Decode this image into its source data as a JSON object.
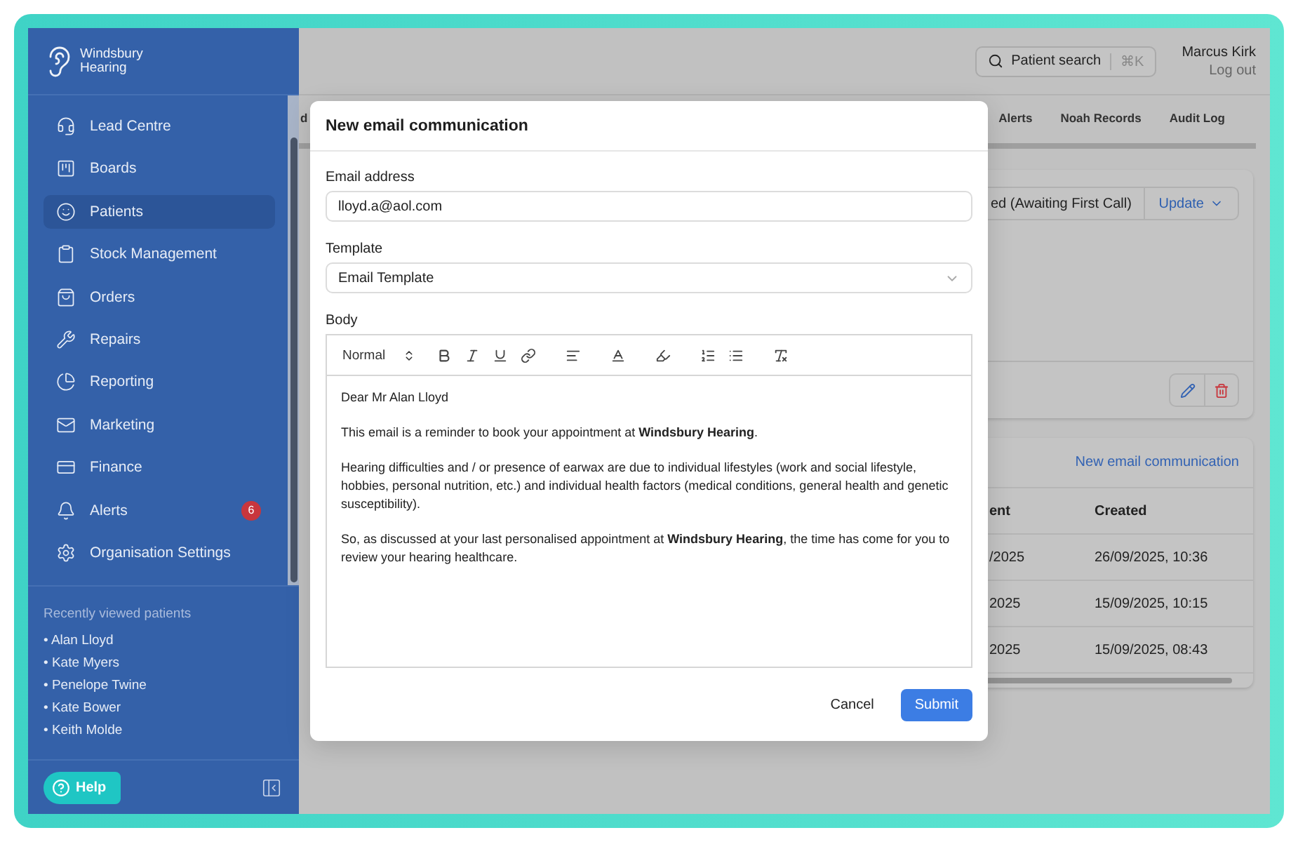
{
  "brand": {
    "lines": [
      "Windsbury",
      "Hearing"
    ]
  },
  "sidebar": {
    "items": [
      {
        "label": "Lead Centre",
        "selected": false
      },
      {
        "label": "Boards",
        "selected": false
      },
      {
        "label": "Patients",
        "selected": true
      },
      {
        "label": "Stock Management",
        "selected": false
      },
      {
        "label": "Orders",
        "selected": false
      },
      {
        "label": "Repairs",
        "selected": false
      },
      {
        "label": "Reporting",
        "selected": false
      },
      {
        "label": "Marketing",
        "selected": false
      },
      {
        "label": "Finance",
        "selected": false
      },
      {
        "label": "Alerts",
        "selected": false,
        "badge": "6"
      },
      {
        "label": "Organisation Settings",
        "selected": false
      }
    ]
  },
  "recent": {
    "title": "Recently viewed patients",
    "patients": [
      "• Alan Lloyd",
      "• Kate Myers",
      "• Penelope Twine",
      "• Kate Bower",
      "• Keith Molde"
    ]
  },
  "help": "Help",
  "header": {
    "search": {
      "label": "Patient search",
      "shortcut": "⌘K"
    },
    "user": {
      "name": "Marcus Kirk",
      "action": "Log out"
    }
  },
  "tabs": [
    {
      "label": "d",
      "selected": false
    },
    {
      "label": "Alerts",
      "selected": false
    },
    {
      "label": "Noah Records",
      "selected": false
    },
    {
      "label": "Audit Log",
      "selected": false
    }
  ],
  "status": {
    "value": "ed (Awaiting First Call)",
    "action": "Update"
  },
  "communications": {
    "link": "New email communication",
    "columns": [
      "ent",
      "Created"
    ],
    "rows": [
      [
        "/2025",
        "26/09/2025, 10:36"
      ],
      [
        "2025",
        "15/09/2025, 10:15"
      ],
      [
        "2025",
        "15/09/2025, 08:43"
      ]
    ]
  },
  "modal": {
    "title": "New email communication",
    "email": {
      "label": "Email address",
      "value": "lloyd.a@aol.com"
    },
    "template": {
      "label": "Template",
      "value": "Email Template"
    },
    "body": {
      "label": "Body",
      "format": "Normal",
      "paragraphs": [
        "Dear Mr Alan Lloyd",
        "This email is a reminder to book your appointment at **Windsbury Hearing**.",
        "Hearing difficulties and / or presence of earwax are due to individual lifestyles (work and social lifestyle, hobbies, personal nutrition, etc.) and individual health factors (medical conditions, general health and genetic susceptibility).",
        "So, as discussed at your last personalised appointment at **Windsbury Hearing**, the time has come for you to review your hearing healthcare."
      ]
    },
    "cancel": "Cancel",
    "submit": "Submit"
  }
}
